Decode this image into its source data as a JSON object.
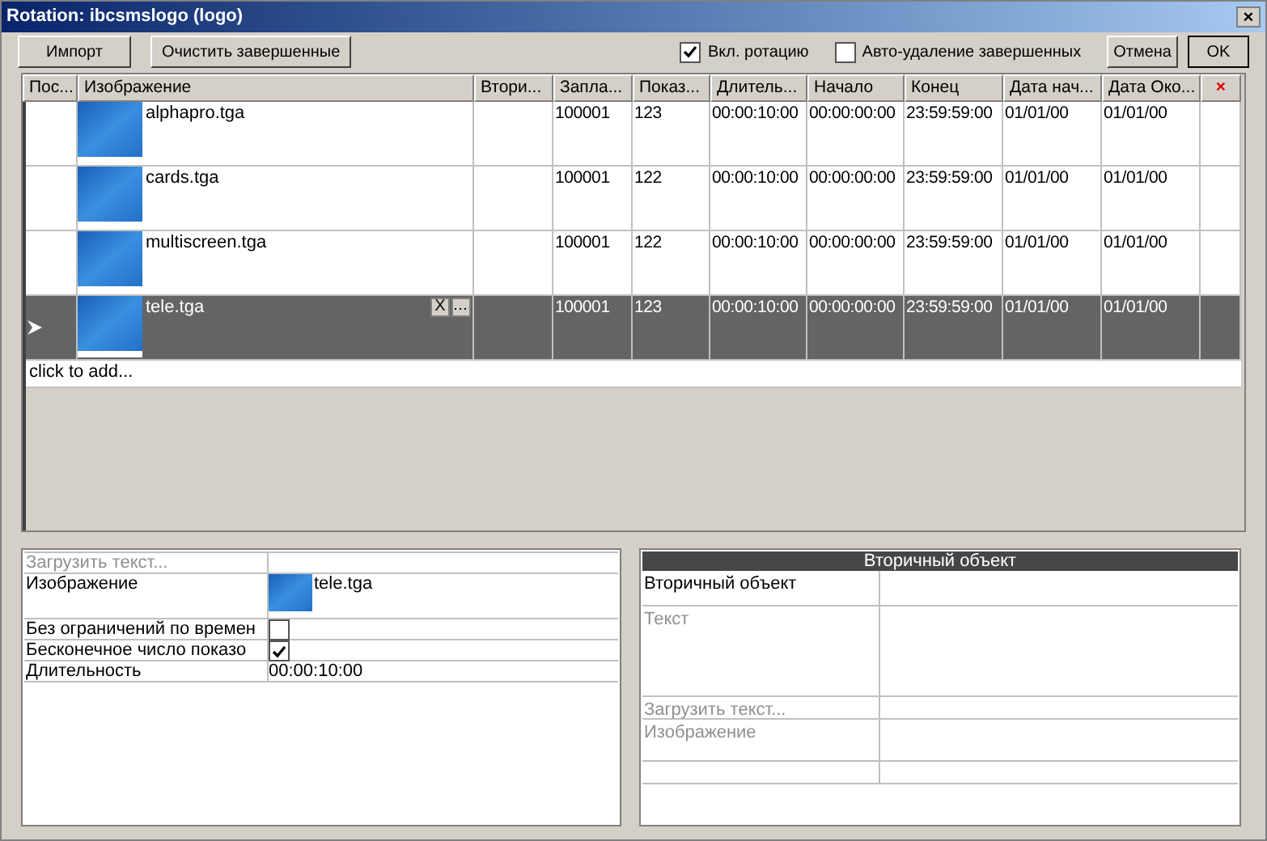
{
  "window": {
    "title": "Rotation: ibcsmslogo (logo)",
    "close": "×"
  },
  "toolbar": {
    "buttons": [
      "Импорт",
      "Очистить завершенные"
    ],
    "options": [
      {
        "label": "Вкл. ротацию",
        "checked": true
      },
      {
        "label": "Авто-удаление завершенных",
        "checked": false
      }
    ],
    "dialog_buttons": [
      "Отмена",
      "OK"
    ]
  },
  "table": {
    "columns": [
      "Пос...",
      "Изображение",
      "Втори...",
      "Запла...",
      "Показ...",
      "Длитель...",
      "Начало",
      "Конец",
      "Дата нач...",
      "Дата Око...",
      "×"
    ],
    "rows": [
      {
        "cells": [
          "",
          "alphapro.tga",
          "",
          "100001",
          "123",
          "00:00:10:00",
          "00:00:00:00",
          "23:59:59:00",
          "01/01/00",
          "01/01/00",
          ""
        ],
        "selected": false
      },
      {
        "cells": [
          "",
          "cards.tga",
          "",
          "100001",
          "122",
          "00:00:10:00",
          "00:00:00:00",
          "23:59:59:00",
          "01/01/00",
          "01/01/00",
          ""
        ],
        "selected": false
      },
      {
        "cells": [
          "",
          "multiscreen.tga",
          "",
          "100001",
          "122",
          "00:00:10:00",
          "00:00:00:00",
          "23:59:59:00",
          "01/01/00",
          "01/01/00",
          ""
        ],
        "selected": false
      },
      {
        "cells": [
          "",
          "tele.tga",
          "",
          "100001",
          "123",
          "00:00:10:00",
          "00:00:00:00",
          "23:59:59:00",
          "01/01/00",
          "01/01/00",
          ""
        ],
        "selected": true
      }
    ],
    "row_buttons": [
      "X"
    ],
    "add_row": "click to add..."
  },
  "properties": [
    {
      "kind": "text",
      "label": "Загрузить текст...",
      "disabled": true
    },
    {
      "kind": "image",
      "label": "Изображение",
      "value": "tele.tga",
      "disabled": false
    },
    {
      "kind": "checkbox",
      "label": "Без ограничений по времен",
      "checked": false,
      "disabled": false
    },
    {
      "kind": "checkbox",
      "label": "Бесконечное число показо",
      "checked": true,
      "disabled": false
    },
    {
      "kind": "text",
      "label": "Длительность",
      "value": "00:00:10:00",
      "disabled": false
    }
  ],
  "secondary": {
    "title": "Вторичный объект",
    "rows": [
      {
        "kind": "field",
        "label": "Вторичный объект",
        "disabled": false
      },
      {
        "kind": "textarea",
        "label": "Текст",
        "disabled": true
      },
      {
        "kind": "link",
        "label": "Загрузить текст...",
        "disabled": true
      },
      {
        "kind": "image",
        "label": "Изображение",
        "disabled": true
      },
      {
        "kind": "link"
      }
    ]
  }
}
